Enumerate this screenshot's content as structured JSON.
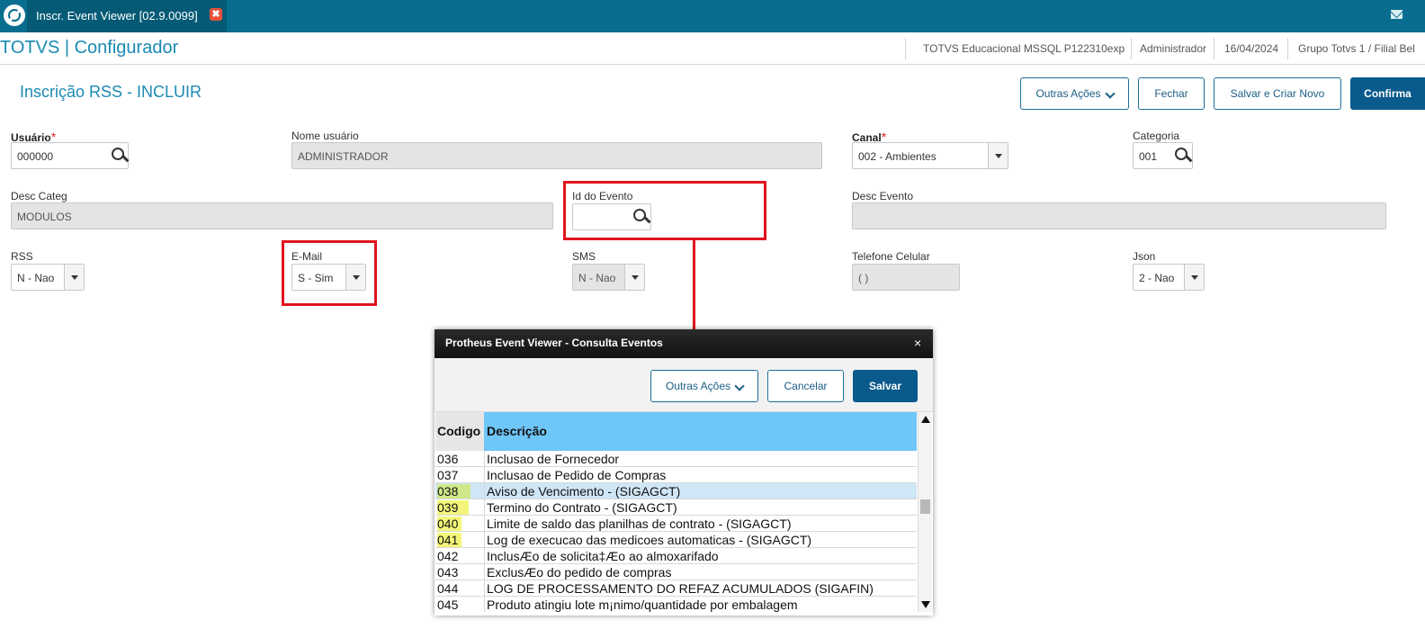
{
  "tabbar": {
    "tab_label": "Inscr. Event Viewer [02.9.0099]",
    "tab_close": "✖"
  },
  "header": {
    "app_title": "TOTVS | Configurador",
    "environment": "TOTVS Educacional MSSQL P122310exp",
    "user": "Administrador",
    "date": "16/04/2024",
    "branch": "Grupo Totvs 1 / Filial Bel"
  },
  "page": {
    "title": "Inscrição RSS - INCLUIR",
    "buttons": {
      "outras_acoes": "Outras Ações",
      "fechar": "Fechar",
      "salvar_criar": "Salvar e Criar Novo",
      "confirmar": "Confirma"
    }
  },
  "form": {
    "usuario": {
      "label": "Usuário",
      "required": "*",
      "value": "000000"
    },
    "nome_usuario": {
      "label": "Nome usuário",
      "value": "ADMINISTRADOR"
    },
    "canal": {
      "label": "Canal",
      "required": "*",
      "value": "002 - Ambientes"
    },
    "categoria": {
      "label": "Categoria",
      "value": "001"
    },
    "desc_categ": {
      "label": "Desc Categ",
      "value": "MODULOS"
    },
    "id_evento": {
      "label": "Id do Evento",
      "value": ""
    },
    "desc_evento": {
      "label": "Desc Evento",
      "value": ""
    },
    "rss": {
      "label": "RSS",
      "value": "N - Nao"
    },
    "email": {
      "label": "E-Mail",
      "value": "S - Sim"
    },
    "sms": {
      "label": "SMS",
      "value": "N - Nao"
    },
    "telefone": {
      "label": "Telefone Celular",
      "value": "( )"
    },
    "json": {
      "label": "Json",
      "value": "2 - Nao"
    }
  },
  "dialog": {
    "title": "Protheus Event Viewer - Consulta Eventos",
    "close": "×",
    "buttons": {
      "outras_acoes": "Outras Ações",
      "cancelar": "Cancelar",
      "salvar": "Salvar"
    },
    "columns": {
      "code": "Codigo",
      "desc": "Descrição"
    },
    "rows": [
      {
        "code": "036",
        "desc": "Inclusao de Fornecedor"
      },
      {
        "code": "037",
        "desc": "Inclusao de Pedido de Compras"
      },
      {
        "code": "038",
        "desc": "Aviso de Vencimento - (SIGAGCT)"
      },
      {
        "code": "039",
        "desc": "Termino do Contrato - (SIGAGCT)"
      },
      {
        "code": "040",
        "desc": "Limite de saldo das planilhas de contrato - (SIGAGCT)"
      },
      {
        "code": "041",
        "desc": "Log de execucao das medicoes automaticas - (SIGAGCT)"
      },
      {
        "code": "042",
        "desc": "InclusÆo de solicita‡Æo ao almoxarifado"
      },
      {
        "code": "043",
        "desc": "ExclusÆo do pedido de compras"
      },
      {
        "code": "044",
        "desc": "LOG DE PROCESSAMENTO DO REFAZ ACUMULADOS (SIGAFIN)"
      },
      {
        "code": "045",
        "desc": "Produto atingiu lote m¡nimo/quantidade por embalagem"
      }
    ]
  },
  "colors": {
    "topbar": "#086d8e",
    "accent": "#1b8ab3",
    "primary_button": "#0a5a8c",
    "annotation_red": "#e0141e",
    "grid_header": "#6ec6f9",
    "highlight_yellow": "#f3f57a"
  }
}
